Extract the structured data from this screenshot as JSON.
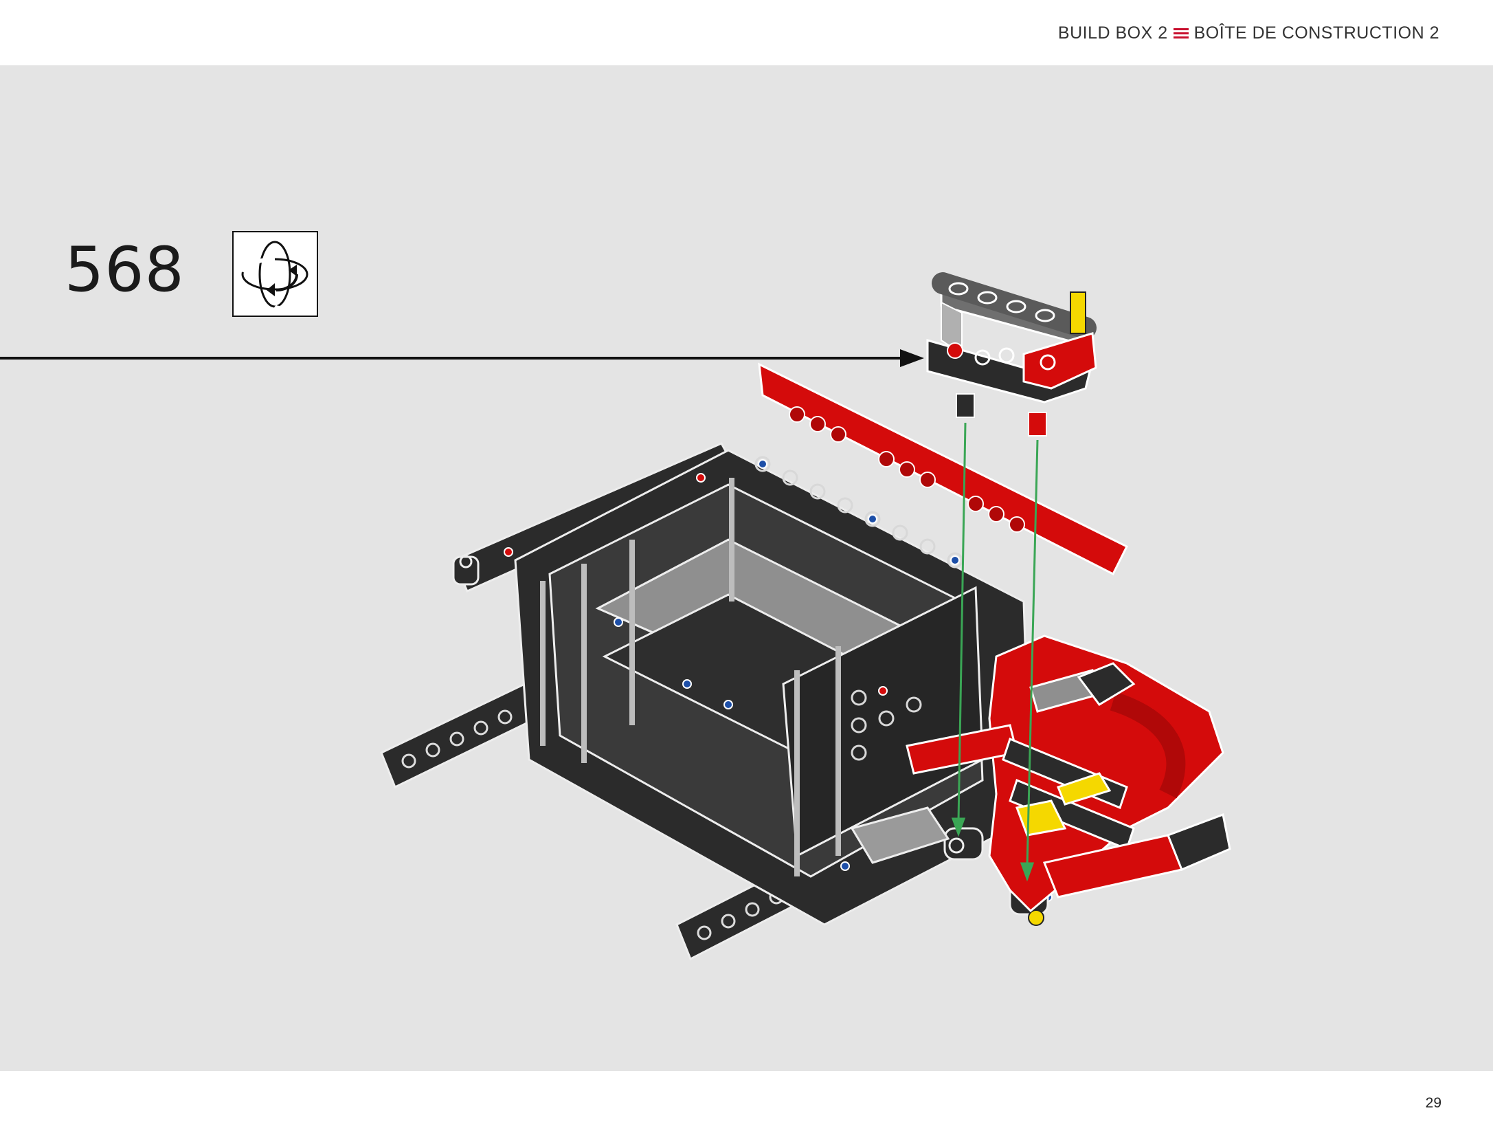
{
  "header": {
    "title_en": "BUILD BOX 2",
    "title_fr": "BOÎTE DE CONSTRUCTION 2",
    "accent_color": "#c8102e"
  },
  "step": {
    "number": "568",
    "rotate_icon": "rotate-model-icon"
  },
  "footer": {
    "page_number": "29"
  },
  "illustration": {
    "icons": [
      "lego-technic-assembly",
      "insertion-arrow-black",
      "placement-arrow-green"
    ],
    "colors": {
      "background": "#e4e4e4",
      "beam_black": "#2b2b2b",
      "beam_red": "#d40b0b",
      "gray": "#8f8f8f",
      "yellow": "#f5d800",
      "blue_pin": "#1d4fa8",
      "guide_green": "#3aa655"
    }
  }
}
